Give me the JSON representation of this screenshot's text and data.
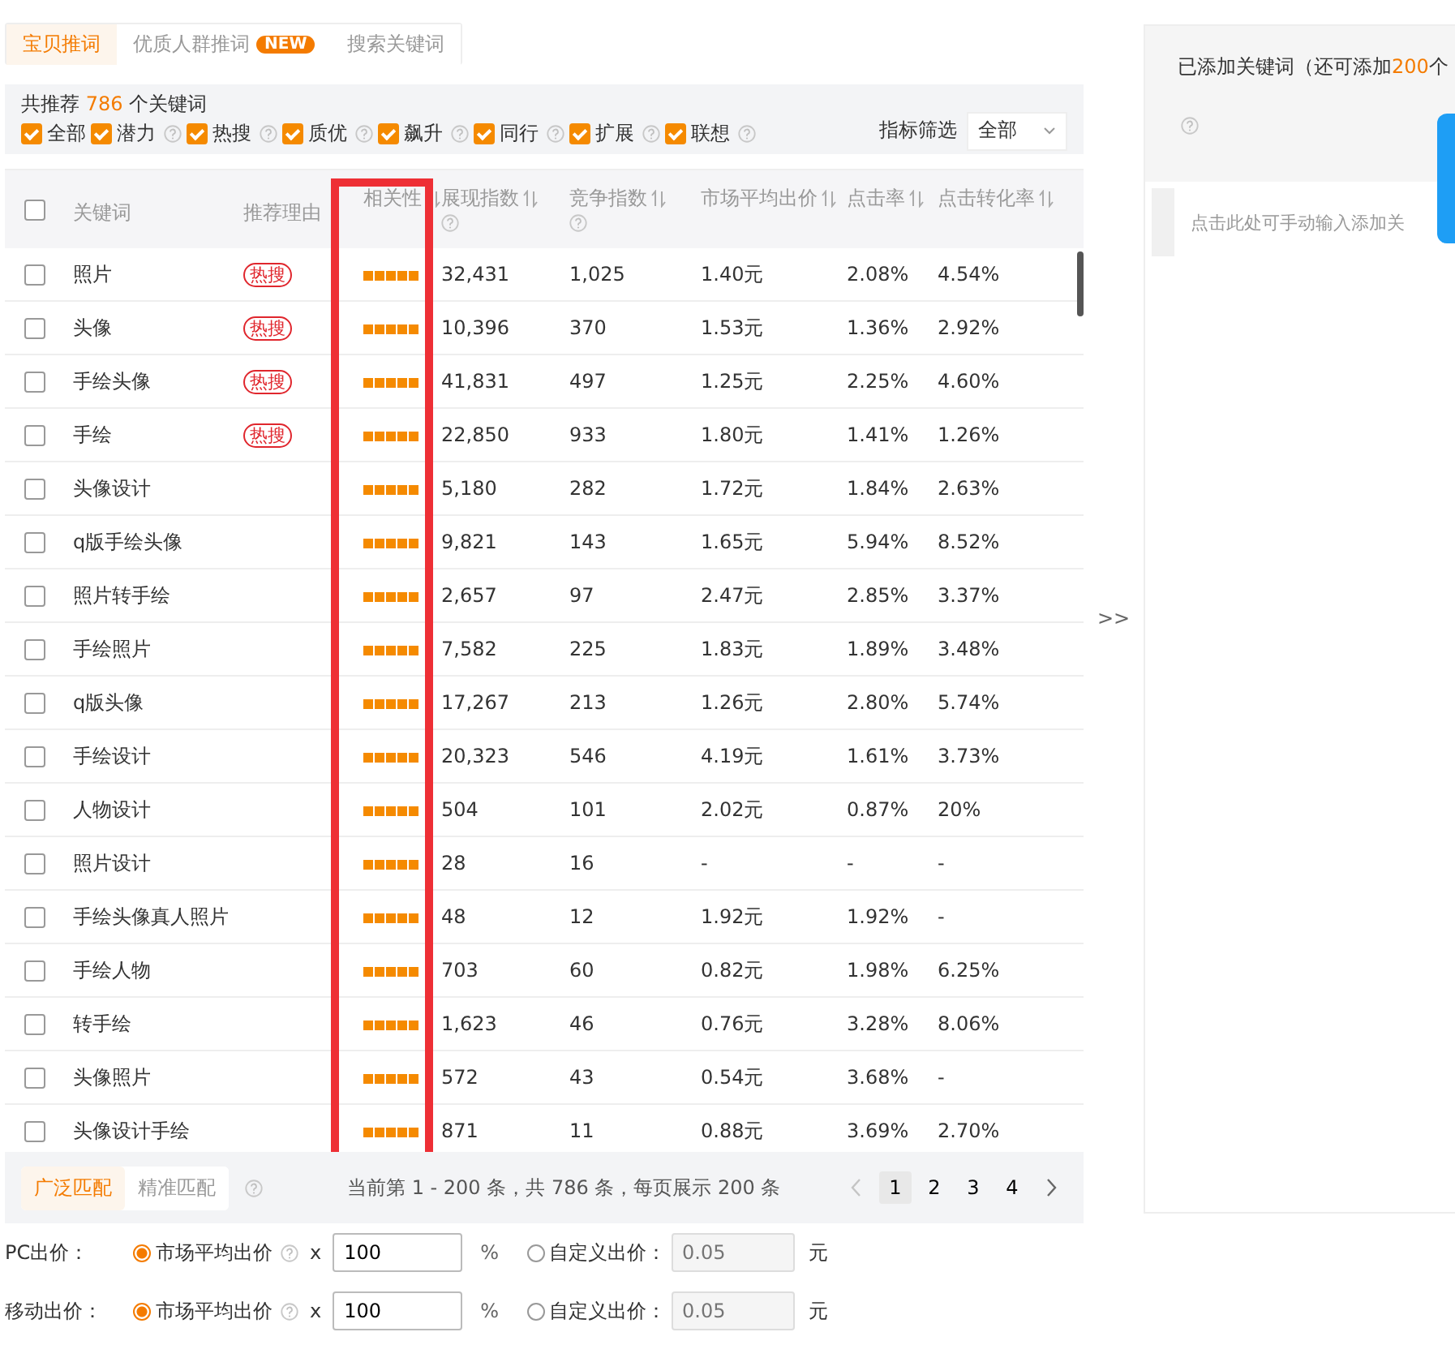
{
  "tabs": [
    {
      "label": "宝贝推词",
      "selected": true
    },
    {
      "label": "优质人群推词",
      "badge": "NEW",
      "selected": false
    },
    {
      "label": "搜索关键词",
      "selected": false
    }
  ],
  "summary": {
    "prefix": "共推荐",
    "count": "786",
    "suffix": "个关键词"
  },
  "filters": [
    {
      "label": "全部",
      "checked": true,
      "help": false
    },
    {
      "label": "潜力",
      "checked": true,
      "help": true
    },
    {
      "label": "热搜",
      "checked": true,
      "help": true
    },
    {
      "label": "质优",
      "checked": true,
      "help": true
    },
    {
      "label": "飙升",
      "checked": true,
      "help": true
    },
    {
      "label": "同行",
      "checked": true,
      "help": true
    },
    {
      "label": "扩展",
      "checked": true,
      "help": true
    },
    {
      "label": "联想",
      "checked": true,
      "help": true
    }
  ],
  "metric_filter": {
    "label": "指标筛选",
    "value": "全部"
  },
  "table": {
    "header_checked": false,
    "columns": [
      {
        "label": "关键词",
        "sort": false,
        "help": false
      },
      {
        "label": "推荐理由",
        "sort": false,
        "help": false
      },
      {
        "label": "相关性",
        "sort": true,
        "help": false
      },
      {
        "label": "展现指数",
        "sort": true,
        "help": true
      },
      {
        "label": "竞争指数",
        "sort": true,
        "help": true
      },
      {
        "label": "市场平均出价",
        "sort": true,
        "help": false
      },
      {
        "label": "点击率",
        "sort": true,
        "help": false
      },
      {
        "label": "点击转化率",
        "sort": true,
        "help": false
      }
    ],
    "rows": [
      {
        "checked": false,
        "keyword": "照片",
        "reason": "热搜",
        "stars": 5,
        "exposure": "32,431",
        "competition": "1,025",
        "price": "1.40元",
        "ctr": "2.08%",
        "cvr": "4.54%"
      },
      {
        "checked": false,
        "keyword": "头像",
        "reason": "热搜",
        "stars": 5,
        "exposure": "10,396",
        "competition": "370",
        "price": "1.53元",
        "ctr": "1.36%",
        "cvr": "2.92%"
      },
      {
        "checked": false,
        "keyword": "手绘头像",
        "reason": "热搜",
        "stars": 5,
        "exposure": "41,831",
        "competition": "497",
        "price": "1.25元",
        "ctr": "2.25%",
        "cvr": "4.60%"
      },
      {
        "checked": false,
        "keyword": "手绘",
        "reason": "热搜",
        "stars": 5,
        "exposure": "22,850",
        "competition": "933",
        "price": "1.80元",
        "ctr": "1.41%",
        "cvr": "1.26%"
      },
      {
        "checked": false,
        "keyword": "头像设计",
        "stars": 5,
        "exposure": "5,180",
        "competition": "282",
        "price": "1.72元",
        "ctr": "1.84%",
        "cvr": "2.63%"
      },
      {
        "checked": false,
        "keyword": "q版手绘头像",
        "stars": 5,
        "exposure": "9,821",
        "competition": "143",
        "price": "1.65元",
        "ctr": "5.94%",
        "cvr": "8.52%"
      },
      {
        "checked": false,
        "keyword": "照片转手绘",
        "stars": 5,
        "exposure": "2,657",
        "competition": "97",
        "price": "2.47元",
        "ctr": "2.85%",
        "cvr": "3.37%"
      },
      {
        "checked": false,
        "keyword": "手绘照片",
        "stars": 5,
        "exposure": "7,582",
        "competition": "225",
        "price": "1.83元",
        "ctr": "1.89%",
        "cvr": "3.48%"
      },
      {
        "checked": false,
        "keyword": "q版头像",
        "stars": 5,
        "exposure": "17,267",
        "competition": "213",
        "price": "1.26元",
        "ctr": "2.80%",
        "cvr": "5.74%"
      },
      {
        "checked": false,
        "keyword": "手绘设计",
        "stars": 5,
        "exposure": "20,323",
        "competition": "546",
        "price": "4.19元",
        "ctr": "1.61%",
        "cvr": "3.73%"
      },
      {
        "checked": false,
        "keyword": "人物设计",
        "stars": 5,
        "exposure": "504",
        "competition": "101",
        "price": "2.02元",
        "ctr": "0.87%",
        "cvr": "20%"
      },
      {
        "checked": false,
        "keyword": "照片设计",
        "stars": 5,
        "exposure": "28",
        "competition": "16",
        "price": "-",
        "ctr": "-",
        "cvr": "-"
      },
      {
        "checked": false,
        "keyword": "手绘头像真人照片",
        "stars": 5,
        "exposure": "48",
        "competition": "12",
        "price": "1.92元",
        "ctr": "1.92%",
        "cvr": "-"
      },
      {
        "checked": false,
        "keyword": "手绘人物",
        "stars": 5,
        "exposure": "703",
        "competition": "60",
        "price": "0.82元",
        "ctr": "1.98%",
        "cvr": "6.25%"
      },
      {
        "checked": false,
        "keyword": "转手绘",
        "stars": 5,
        "exposure": "1,623",
        "competition": "46",
        "price": "0.76元",
        "ctr": "3.28%",
        "cvr": "8.06%"
      },
      {
        "checked": false,
        "keyword": "头像照片",
        "stars": 5,
        "exposure": "572",
        "competition": "43",
        "price": "0.54元",
        "ctr": "3.68%",
        "cvr": "-"
      },
      {
        "checked": false,
        "keyword": "头像设计手绘",
        "stars": 5,
        "exposure": "871",
        "competition": "11",
        "price": "0.88元",
        "ctr": "3.69%",
        "cvr": "2.70%"
      }
    ]
  },
  "match_types": [
    {
      "label": "广泛匹配",
      "selected": true
    },
    {
      "label": "精准匹配",
      "selected": false
    }
  ],
  "page_info": "当前第 1 - 200 条，共 786 条，每页展示 200 条",
  "pages": [
    {
      "label": "1",
      "selected": true
    },
    {
      "label": "2",
      "selected": false
    },
    {
      "label": "3",
      "selected": false
    },
    {
      "label": "4",
      "selected": false
    }
  ],
  "bids": [
    {
      "label": "PC出价：",
      "market_label": "市场平均出价",
      "market_selected": true,
      "times": "x",
      "percent": "100",
      "unit_percent": "%",
      "custom_label": "自定义出价：",
      "custom_selected": false,
      "custom_placeholder": "0.05",
      "unit": "元"
    },
    {
      "label": "移动出价：",
      "market_label": "市场平均出价",
      "market_selected": true,
      "times": "x",
      "percent": "100",
      "unit_percent": "%",
      "custom_label": "自定义出价：",
      "custom_selected": false,
      "custom_placeholder": "0.05",
      "unit": "元"
    }
  ],
  "expand_toggle": ">>",
  "added_panel": {
    "title_prefix": "已添加关键词（还可添加",
    "count": "200",
    "title_suffix": "个",
    "input_placeholder": "点击此处可手动输入添加关"
  }
}
